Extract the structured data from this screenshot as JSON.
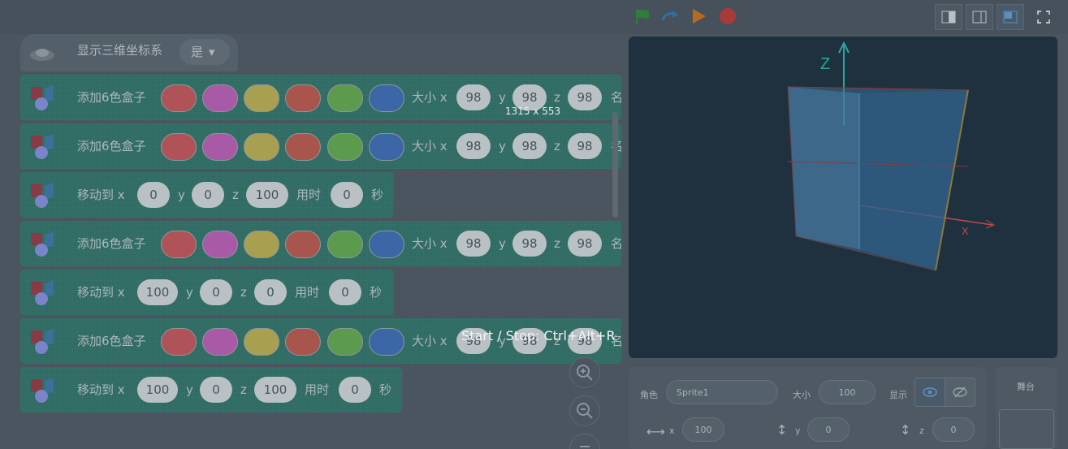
{
  "toolbar": {
    "green_flag_icon": "green-flag-icon",
    "redo_icon": "redo-icon",
    "play_icon": "play-icon",
    "stop_icon": "stop-icon",
    "colors": {
      "flag": "#2e7d3b",
      "redo": "#2f6fa8",
      "play": "#b86a1f",
      "stop": "#a83a3a"
    }
  },
  "hat_block": {
    "label": "显示三维坐标系",
    "dropdown": "是"
  },
  "blocks": [
    {
      "type": "add_box",
      "label": "添加6色盒子",
      "size_label": "大小 x",
      "x": "98",
      "y_label": "y",
      "y": "98",
      "z_label": "z",
      "z": "98",
      "tail": "名"
    },
    {
      "type": "add_box",
      "label": "添加6色盒子",
      "size_label": "大小 x",
      "x": "98",
      "y_label": "y",
      "y": "98",
      "z_label": "z",
      "z": "98",
      "tail": "名"
    },
    {
      "type": "move",
      "label": "移动到 x",
      "x": "0",
      "y_label": "y",
      "y": "0",
      "z_label": "z",
      "z": "100",
      "time_label": "用时",
      "time": "0",
      "sec": "秒"
    },
    {
      "type": "add_box",
      "label": "添加6色盒子",
      "size_label": "大小 x",
      "x": "98",
      "y_label": "y",
      "y": "98",
      "z_label": "z",
      "z": "98",
      "tail": "名"
    },
    {
      "type": "move",
      "label": "移动到 x",
      "x": "100",
      "y_label": "y",
      "y": "0",
      "z_label": "z",
      "z": "0",
      "time_label": "用时",
      "time": "0",
      "sec": "秒"
    },
    {
      "type": "add_box",
      "label": "添加6色盒子",
      "size_label": "大小 x",
      "x": "98",
      "y_label": "y",
      "y": "98",
      "z_label": "z",
      "z": "98",
      "tail": "名"
    },
    {
      "type": "move",
      "label": "移动到 x",
      "x": "100",
      "y_label": "y",
      "y": "0",
      "z_label": "z",
      "z": "100",
      "time_label": "用时",
      "time": "0",
      "sec": "秒"
    }
  ],
  "swatch_colors": [
    "#b05358",
    "#a85aa6",
    "#a8a050",
    "#a8554e",
    "#5c9a4e",
    "#3b67a6"
  ],
  "overlay": {
    "size_text": "1315 x 553",
    "hint": "Start / Stop: Ctrl+Alt+R"
  },
  "stage": {
    "axis_z": "Z",
    "axis_x": "X"
  },
  "sprite_info": {
    "role_label": "角色",
    "name": "Sprite1",
    "size_label": "大小",
    "size": "100",
    "show_label": "显示",
    "x_label": "x",
    "x": "100",
    "y_label": "y",
    "y": "0",
    "z_label": "z",
    "z": "0"
  },
  "stage_panel": {
    "label": "舞台"
  }
}
